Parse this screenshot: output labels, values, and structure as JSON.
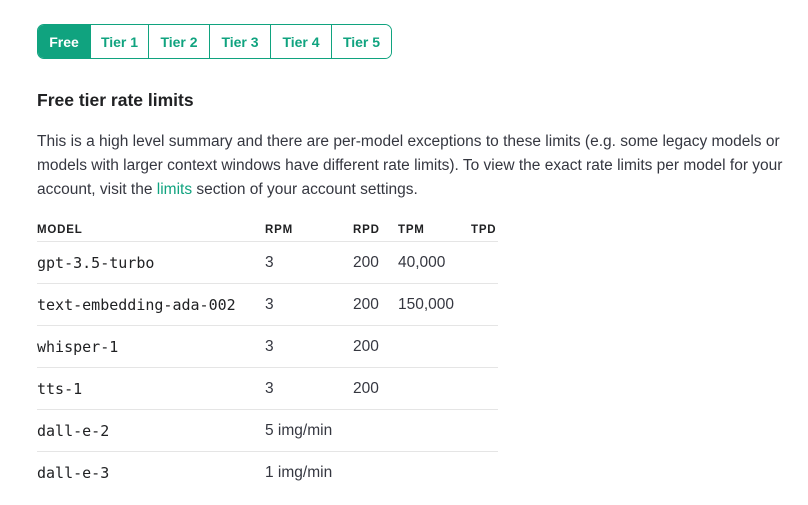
{
  "tiers": {
    "items": [
      {
        "label": "Free",
        "active": true
      },
      {
        "label": "Tier 1",
        "active": false
      },
      {
        "label": "Tier 2",
        "active": false
      },
      {
        "label": "Tier 3",
        "active": false
      },
      {
        "label": "Tier 4",
        "active": false
      },
      {
        "label": "Tier 5",
        "active": false
      }
    ]
  },
  "heading": "Free tier rate limits",
  "summary": {
    "text_before": "This is a high level summary and there are per-model exceptions to these limits (e.g. some legacy models or models with larger context windows have different rate limits). To view the exact rate limits per model for your account, visit the ",
    "link_text": "limits",
    "text_after": " section of your account settings."
  },
  "table": {
    "headers": [
      "MODEL",
      "RPM",
      "RPD",
      "TPM",
      "TPD"
    ],
    "rows": [
      {
        "model": "gpt-3.5-turbo",
        "rpm": "3",
        "rpd": "200",
        "tpm": "40,000",
        "tpd": ""
      },
      {
        "model": "text-embedding-ada-002",
        "rpm": "3",
        "rpd": "200",
        "tpm": "150,000",
        "tpd": ""
      },
      {
        "model": "whisper-1",
        "rpm": "3",
        "rpd": "200",
        "tpm": "",
        "tpd": ""
      },
      {
        "model": "tts-1",
        "rpm": "3",
        "rpd": "200",
        "tpm": "",
        "tpd": ""
      },
      {
        "model": "dall-e-2",
        "rpm": "5 img/min",
        "rpd": "",
        "tpm": "",
        "tpd": ""
      },
      {
        "model": "dall-e-3",
        "rpm": "1 img/min",
        "rpd": "",
        "tpm": "",
        "tpd": ""
      }
    ]
  },
  "colors": {
    "accent": "#10a37f",
    "text": "#202123",
    "body_text": "#353740",
    "divider": "#e5e5e5"
  }
}
